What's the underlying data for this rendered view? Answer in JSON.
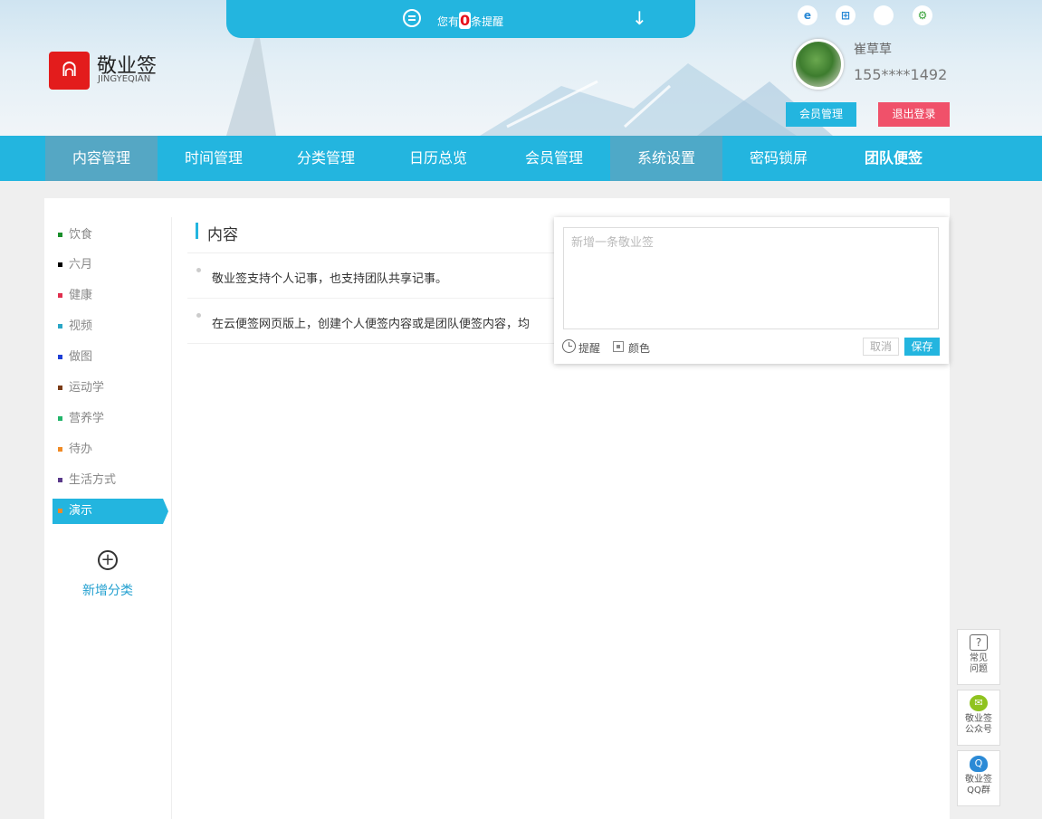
{
  "notice": {
    "prefix": "您有",
    "count": "0",
    "suffix": "条提醒",
    "arrow": "↓"
  },
  "brand": {
    "logo": "ᕱ",
    "name": "敬业签",
    "sub": "JINGYEQIAN"
  },
  "platforms": [
    {
      "icon": "ie-icon",
      "glyph": "e"
    },
    {
      "icon": "windows-icon",
      "glyph": "⊞"
    },
    {
      "icon": "apple-icon",
      "glyph": ""
    },
    {
      "icon": "android-icon",
      "glyph": "⚙"
    }
  ],
  "user": {
    "name": "崔草草",
    "phone": "155****1492",
    "member_btn": "会员管理",
    "logout_btn": "退出登录"
  },
  "nav": [
    "内容管理",
    "时间管理",
    "分类管理",
    "日历总览",
    "会员管理",
    "系统设置",
    "密码锁屏",
    "团队便签"
  ],
  "categories": [
    {
      "label": "饮食",
      "color": "#1a8f2b"
    },
    {
      "label": "六月",
      "color": "#000000"
    },
    {
      "label": "健康",
      "color": "#e0304e"
    },
    {
      "label": "视频",
      "color": "#2aa6c6"
    },
    {
      "label": "做图",
      "color": "#1f3fd6"
    },
    {
      "label": "运动学",
      "color": "#7a3b16"
    },
    {
      "label": "营养学",
      "color": "#22b56b"
    },
    {
      "label": "待办",
      "color": "#f08a24"
    },
    {
      "label": "生活方式",
      "color": "#5a3a8a"
    },
    {
      "label": "演示",
      "color": "#f08a24",
      "active": true
    }
  ],
  "add_category": {
    "icon": "+",
    "label": "新增分类"
  },
  "section": {
    "title": "内容"
  },
  "items": [
    "敬业签支持个人记事，也支持团队共享记事。",
    "在云便签网页版上，创建个人便签内容或是团队便签内容，均"
  ],
  "editor": {
    "placeholder": "新增一条敬业签",
    "remind": "提醒",
    "color": "颜色",
    "cancel": "取消",
    "save": "保存"
  },
  "tools": [
    {
      "icon": "help-icon",
      "glyph": "?",
      "label1": "常见",
      "label2": "问题"
    },
    {
      "icon": "wechat-icon",
      "glyph": "✉",
      "label1": "敬业签",
      "label2": "公众号"
    },
    {
      "icon": "qq-icon",
      "glyph": "Q",
      "label1": "敬业签",
      "label2": "QQ群"
    }
  ],
  "colors": {
    "accent": "#23b5df",
    "logout": "#f0516a",
    "logo": "#e31c1c",
    "active_nav": "#55a7c4"
  }
}
